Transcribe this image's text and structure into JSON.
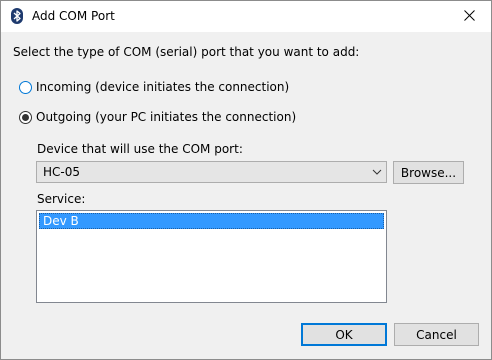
{
  "window": {
    "title": "Add COM Port",
    "icon": "bluetooth-icon",
    "close_icon": "close-icon"
  },
  "prompt": "Select the type of COM (serial) port that you want to add:",
  "direction": {
    "options": [
      {
        "label": "Incoming (device initiates the connection)",
        "selected": false
      },
      {
        "label": "Outgoing (your PC initiates the connection)",
        "selected": true
      }
    ]
  },
  "device": {
    "label": "Device that will use the COM port:",
    "value": "HC-05",
    "browse_label": "Browse..."
  },
  "service": {
    "label": "Service:",
    "items": [
      "Dev B"
    ],
    "selected_index": 0
  },
  "footer": {
    "ok_label": "OK",
    "cancel_label": "Cancel"
  },
  "colors": {
    "accent": "#0078d7",
    "selection": "#3399ff",
    "bluetooth_icon_bg": "#1e3a6e"
  }
}
